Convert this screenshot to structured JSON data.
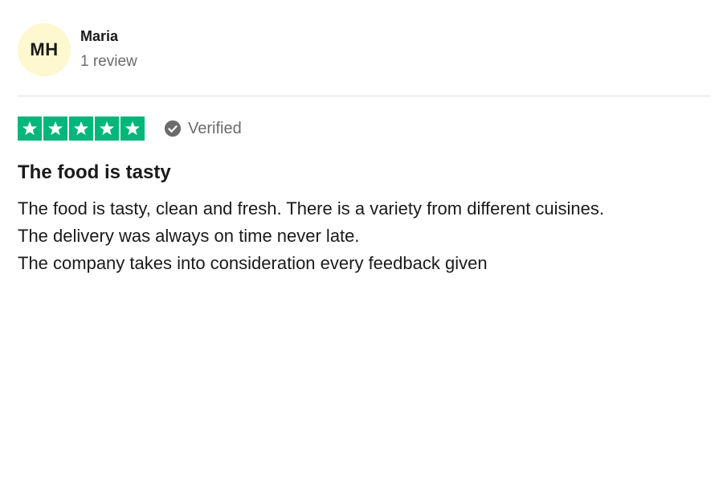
{
  "consumer": {
    "initials": "MH",
    "name": "Maria",
    "review_count": "1 review",
    "avatar_color": "#fdf8d0"
  },
  "rating": {
    "stars": 5,
    "max_stars": 5,
    "star_color": "#00b67a",
    "verified_label": "Verified"
  },
  "review": {
    "title": "The food is tasty",
    "lines": [
      "The food is tasty, clean and fresh. There is a variety from different cuisines.",
      "The delivery was always on time never late.",
      "The company takes into consideration every feedback given"
    ]
  }
}
